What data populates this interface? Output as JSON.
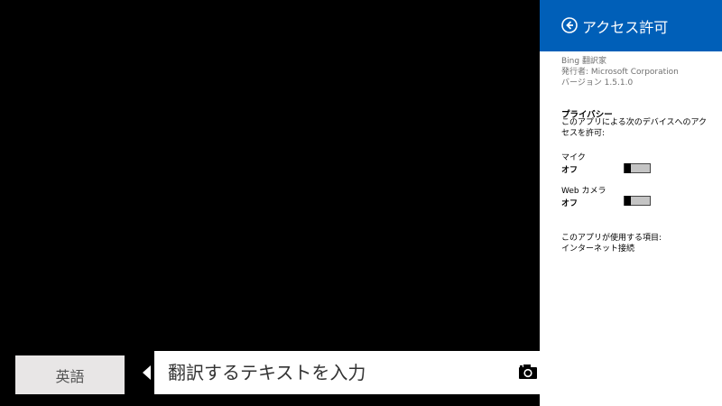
{
  "app": {
    "language_button_label": "英語",
    "text_input_placeholder": "翻訳するテキストを入力",
    "camera_icon": "camera-icon"
  },
  "settings_pane": {
    "title": "アクセス許可",
    "back_icon": "back-arrow-icon",
    "accent_color": "#005fb8",
    "app_name": "Bing 翻訳家",
    "publisher": "発行者: Microsoft Corporation",
    "version": "バージョン 1.5.1.0",
    "privacy_heading": "プライバシー",
    "privacy_description": "このアプリによる次のデバイスへのアクセスを許可:",
    "permissions": [
      {
        "label": "マイク",
        "state": "オフ",
        "enabled": false
      },
      {
        "label": "Web カメラ",
        "state": "オフ",
        "enabled": false
      }
    ],
    "usage_heading": "このアプリが使用する項目:",
    "usage_items": [
      "インターネット接続"
    ]
  }
}
